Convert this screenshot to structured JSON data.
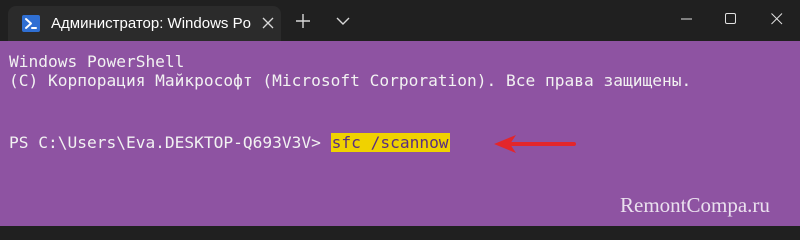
{
  "titlebar": {
    "tab_title": "Администратор: Windows Po",
    "tab_icon": "powershell-icon",
    "close_icon": "close-icon",
    "new_tab_icon": "plus-icon",
    "dropdown_icon": "chevron-down-icon",
    "window_controls": [
      "minimize-icon",
      "maximize-icon",
      "close-icon"
    ]
  },
  "terminal": {
    "line1": "Windows PowerShell",
    "line2": "(C) Корпорация Майкрософт (Microsoft Corporation). Все права защищены.",
    "prompt": "PS C:\\Users\\Eva.DESKTOP-Q693V3V> ",
    "command": "sfc /scannow"
  },
  "watermark": "RemontCompa.ru",
  "colors": {
    "background": "#8e53a2",
    "titlebar": "#202020",
    "tab": "#2b2b2b",
    "highlight": "#f0d200",
    "arrow": "#e3262b"
  }
}
